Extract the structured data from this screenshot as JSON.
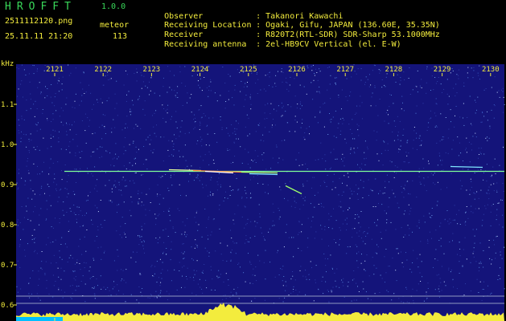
{
  "header": {
    "app_title": "HROFFT",
    "app_version": "1.0.0",
    "file_name": "2511112120.png",
    "timestamp": "25.11.11 21:20",
    "meteor_label": "meteor",
    "meteor_count": "113"
  },
  "info": [
    {
      "label": "Observer",
      "value": "Takanori Kawachi"
    },
    {
      "label": "Receiving Location",
      "value": "Ogaki, Gifu, JAPAN (136.60E, 35.35N)"
    },
    {
      "label": "Receiver",
      "value": "R820T2(RTL-SDR) SDR-Sharp 53.1000MHz"
    },
    {
      "label": "Receiving antenna",
      "value": "2el-HB9CV Vertical (el. E-W)"
    }
  ],
  "info_separator": ":",
  "spectrogram": {
    "y_unit": "kHz",
    "time_ticks": [
      "2121",
      "2122",
      "2123",
      "2124",
      "2125",
      "2126",
      "2127",
      "2128",
      "2129",
      "2130"
    ],
    "freq_ticks": [
      "1.1",
      "1.0",
      "0.9",
      "0.8",
      "0.7",
      "0.6"
    ],
    "freq_tick_values": [
      1.1,
      1.0,
      0.9,
      0.8,
      0.7,
      0.6
    ],
    "signal_freq_khz": 0.93,
    "colors": {
      "background": "#14147a",
      "label": "#f3ec3d",
      "header_green": "#39d95a",
      "signal": "#7fff9a",
      "level_bar": "#f3ec3d",
      "level_bar_edge": "#00bfff"
    }
  }
}
